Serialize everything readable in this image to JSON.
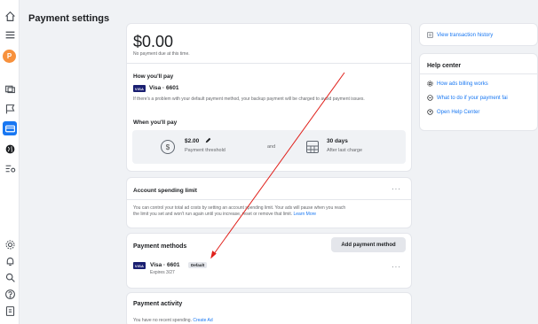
{
  "header": {
    "title": "Payment settings"
  },
  "rail": {
    "avatar_letter": "P"
  },
  "balance": {
    "amount": "$0.00",
    "note": "No payment due at this time."
  },
  "how_you_pay": {
    "heading": "How you'll pay",
    "card_brand": "VISA",
    "card_label": "Visa · 6601",
    "info": "If there's a problem with your default payment method, your backup payment will be charged to avoid payment issues."
  },
  "when_you_pay": {
    "heading": "When you'll pay",
    "threshold_value": "$2.00",
    "threshold_label": "Payment threshold",
    "connector": "and",
    "days_value": "30 days",
    "days_label": "After last charge"
  },
  "spending_limit": {
    "heading": "Account spending limit",
    "menu": "···",
    "desc_line1": "You can control your total ad costs by setting an account spending limit. Your ads will pause when you reach",
    "desc_line2": "the limit you set and won't run again until you increase, reset or remove that limit.",
    "learn_more": "Learn More"
  },
  "payment_methods": {
    "heading": "Payment methods",
    "add_button": "Add payment method",
    "card_brand": "VISA",
    "card_label": "Visa · 6601",
    "default_badge": "Default",
    "expires": "Expires 3/27",
    "menu": "···"
  },
  "payment_activity": {
    "heading": "Payment activity",
    "text": "You have no recent spending.",
    "link": "Create Ad"
  },
  "sidebar": {
    "view_transactions": "View transaction history",
    "help_heading": "Help center",
    "help_links": [
      "How ads billing works",
      "What to do if your payment fai",
      "Open Help Center"
    ]
  },
  "colors": {
    "accent": "#1877f2",
    "annotation": "#e0201b",
    "avatar": "#f7913d"
  }
}
